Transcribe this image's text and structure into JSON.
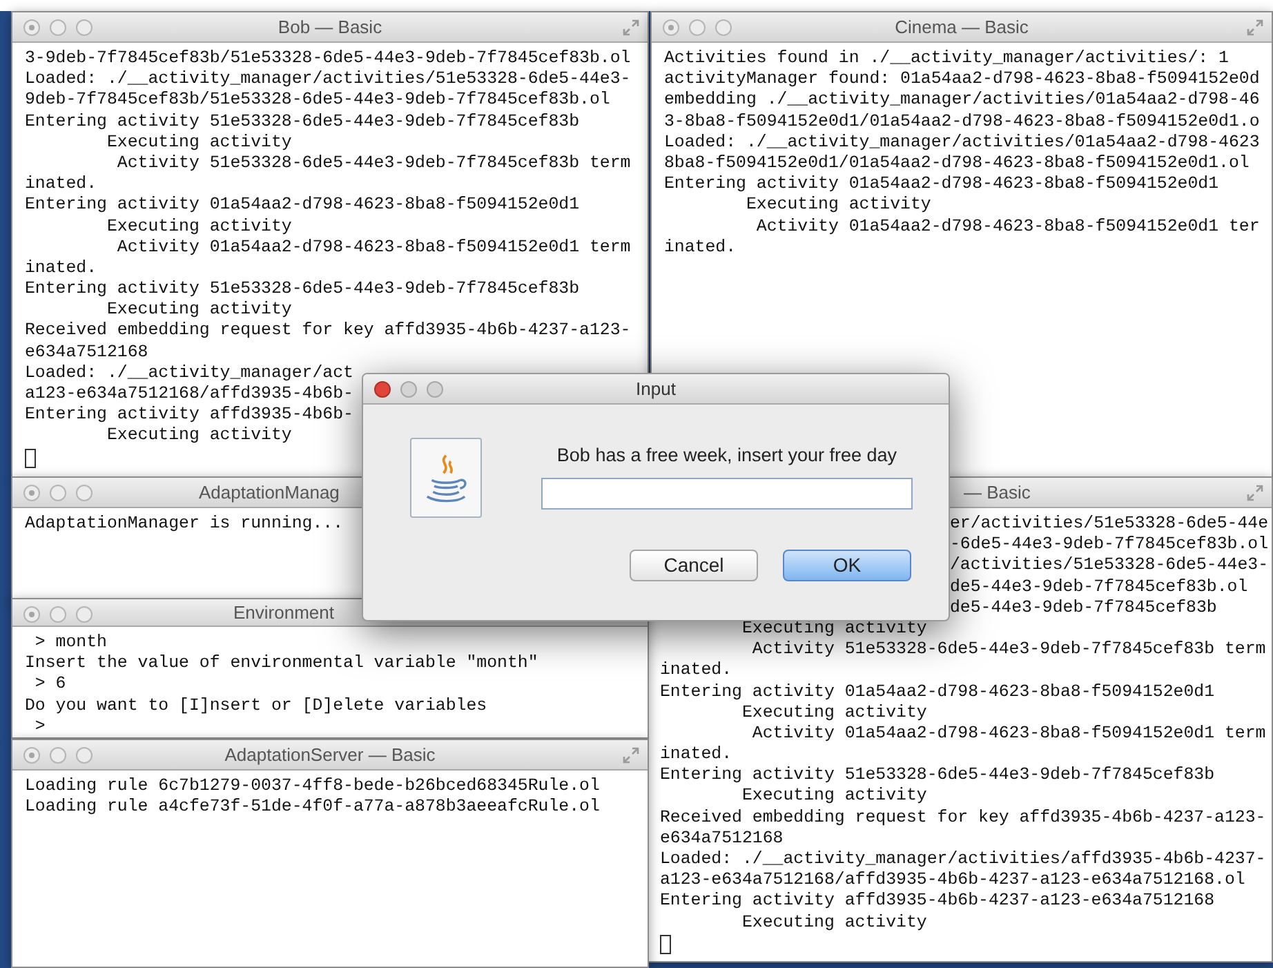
{
  "windows": [
    {
      "title": "Bob — Basic",
      "active": false,
      "resize_icon": true,
      "lines": [
        "3-9deb-7f7845cef83b/51e53328-6de5-44e3-9deb-7f7845cef83b.ol",
        "Loaded: ./__activity_manager/activities/51e53328-6de5-44e3-",
        "9deb-7f7845cef83b/51e53328-6de5-44e3-9deb-7f7845cef83b.ol",
        "Entering activity 51e53328-6de5-44e3-9deb-7f7845cef83b",
        "        Executing activity",
        "         Activity 51e53328-6de5-44e3-9deb-7f7845cef83b term",
        "inated.",
        "Entering activity 01a54aa2-d798-4623-8ba8-f5094152e0d1",
        "        Executing activity",
        "         Activity 01a54aa2-d798-4623-8ba8-f5094152e0d1 term",
        "inated.",
        "Entering activity 51e53328-6de5-44e3-9deb-7f7845cef83b",
        "        Executing activity",
        "Received embedding request for key affd3935-4b6b-4237-a123-",
        "e634a7512168",
        "Loaded: ./__activity_manager/act",
        "a123-e634a7512168/affd3935-4b6b-",
        "Entering activity affd3935-4b6b-",
        "        Executing activity"
      ],
      "cursor": true
    },
    {
      "title": "Cinema — Basic",
      "active": false,
      "resize_icon": true,
      "lines": [
        "Activities found in ./__activity_manager/activities/: 1",
        "activityManager found: 01a54aa2-d798-4623-8ba8-f5094152e0d",
        "embedding ./__activity_manager/activities/01a54aa2-d798-46",
        "3-8ba8-f5094152e0d1/01a54aa2-d798-4623-8ba8-f5094152e0d1.o",
        "Loaded: ./__activity_manager/activities/01a54aa2-d798-4623",
        "8ba8-f5094152e0d1/01a54aa2-d798-4623-8ba8-f5094152e0d1.ol",
        "Entering activity 01a54aa2-d798-4623-8ba8-f5094152e0d1",
        "        Executing activity",
        "         Activity 01a54aa2-d798-4623-8ba8-f5094152e0d1 ter",
        "inated."
      ],
      "cursor": false
    },
    {
      "title": "AdaptationManag",
      "active": false,
      "resize_icon": false,
      "lines": [
        "AdaptationManager is running..."
      ],
      "cursor": false
    },
    {
      "title": "— Basic",
      "active": false,
      "resize_icon": true,
      "line_tails": [
        "er/activities/51e53328-6de5-44e",
        "-6de5-44e3-9deb-7f7845cef83b.ol",
        "/activities/51e53328-6de5-44e3-",
        "de5-44e3-9deb-7f7845cef83b.ol",
        "de5-44e3-9deb-7f7845cef83b"
      ],
      "lines": [
        "        Executing activity",
        "         Activity 51e53328-6de5-44e3-9deb-7f7845cef83b term",
        "inated.",
        "Entering activity 01a54aa2-d798-4623-8ba8-f5094152e0d1",
        "        Executing activity",
        "         Activity 01a54aa2-d798-4623-8ba8-f5094152e0d1 term",
        "inated.",
        "Entering activity 51e53328-6de5-44e3-9deb-7f7845cef83b",
        "        Executing activity",
        "Received embedding request for key affd3935-4b6b-4237-a123-",
        "e634a7512168",
        "Loaded: ./__activity_manager/activities/affd3935-4b6b-4237-",
        "a123-e634a7512168/affd3935-4b6b-4237-a123-e634a7512168.ol",
        "Entering activity affd3935-4b6b-4237-a123-e634a7512168",
        "        Executing activity"
      ],
      "cursor": true
    },
    {
      "title": "Environment",
      "active": false,
      "resize_icon": false,
      "lines": [
        " > month",
        "Insert the value of environmental variable \"month\"",
        " > 6",
        "Do you want to [I]nsert or [D]elete variables",
        " >"
      ],
      "cursor": false
    },
    {
      "title": "AdaptationServer — Basic",
      "active": false,
      "resize_icon": true,
      "lines": [
        "Loading rule 6c7b1279-0037-4ff8-bede-b26bced68345Rule.ol",
        "Loading rule a4cfe73f-51de-4f0f-a77a-a878b3aeeafcRule.ol"
      ],
      "cursor": false
    }
  ],
  "dialog": {
    "title": "Input",
    "active": true,
    "message": "Bob has a free week, insert your free day",
    "buttons": [
      {
        "label": "Cancel",
        "default": false
      },
      {
        "label": "OK",
        "default": true
      }
    ]
  }
}
